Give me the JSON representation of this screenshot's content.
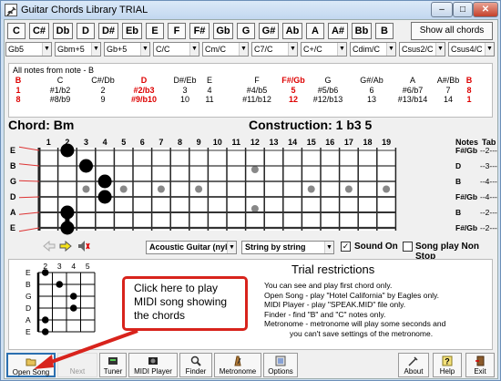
{
  "window": {
    "title": "Guitar Chords Library TRIAL",
    "min": "–",
    "max": "□",
    "close": "✕"
  },
  "note_buttons": [
    "C",
    "C#",
    "Db",
    "D",
    "D#",
    "Eb",
    "E",
    "F",
    "F#",
    "Gb",
    "G",
    "G#",
    "Ab",
    "A",
    "A#",
    "Bb",
    "B"
  ],
  "show_all_label": "Show all chords",
  "chord_dropdowns": [
    "Gb5",
    "Gbm+5",
    "Gb+5",
    "C/C",
    "Cm/C",
    "C7/C",
    "C+/C",
    "Cdim/C",
    "Csus2/C",
    "Csus4/C"
  ],
  "notes_box": {
    "title": "All notes from note - B",
    "columns": [
      {
        "r1": "B",
        "r2": "1",
        "r3": "8",
        "red": true
      },
      {
        "r1": "C",
        "r2": "#1/b2",
        "r3": "#8/b9",
        "red": false
      },
      {
        "r1": "C#/Db",
        "r2": "2",
        "r3": "9",
        "red": false
      },
      {
        "r1": "D",
        "r2": "#2/b3",
        "r3": "#9/b10",
        "red": true
      },
      {
        "r1": "D#/Eb",
        "r2": "3",
        "r3": "10",
        "red": false
      },
      {
        "r1": "E",
        "r2": "4",
        "r3": "11",
        "red": false
      },
      {
        "r1": "F",
        "r2": "#4/b5",
        "r3": "#11/b12",
        "red": false
      },
      {
        "r1": "F#/Gb",
        "r2": "5",
        "r3": "12",
        "red": true
      },
      {
        "r1": "G",
        "r2": "#5/b6",
        "r3": "#12/b13",
        "red": false
      },
      {
        "r1": "G#/Ab",
        "r2": "6",
        "r3": "13",
        "red": false
      },
      {
        "r1": "A",
        "r2": "#6/b7",
        "r3": "#13/b14",
        "red": false
      },
      {
        "r1": "A#/Bb",
        "r2": "7",
        "r3": "14",
        "red": false
      },
      {
        "r1": "B",
        "r2": "8",
        "r3": "1",
        "red": true
      }
    ]
  },
  "chord": {
    "label": "Chord: Bm",
    "construction": "Construction: 1 b3 5"
  },
  "fretboard": {
    "fret_numbers": [
      "1",
      "2",
      "3",
      "4",
      "5",
      "6",
      "7",
      "8",
      "9",
      "10",
      "11",
      "12",
      "13",
      "14",
      "15",
      "16",
      "17",
      "18",
      "19"
    ],
    "notes_header": "Notes",
    "tab_header": "Tab",
    "strings": [
      {
        "name": "E",
        "note": "F#/Gb",
        "tab": "--2---"
      },
      {
        "name": "B",
        "note": "D",
        "tab": "--3---"
      },
      {
        "name": "G",
        "note": "B",
        "tab": "--4---"
      },
      {
        "name": "D",
        "note": "F#/Gb",
        "tab": "--4---"
      },
      {
        "name": "A",
        "note": "B",
        "tab": "--2---"
      },
      {
        "name": "E",
        "note": "F#/Gb",
        "tab": "--2---"
      }
    ],
    "fingers": [
      [
        0,
        2
      ],
      [
        1,
        3
      ],
      [
        2,
        4
      ],
      [
        3,
        4
      ],
      [
        4,
        2
      ],
      [
        5,
        2
      ]
    ],
    "inlays": [
      3,
      5,
      7,
      9,
      15,
      17,
      19
    ],
    "double_inlay": 12,
    "barre": {
      "fret": 2,
      "from": 4,
      "to": 5
    }
  },
  "controls": {
    "instrument": "Acoustic Guitar (nylon",
    "strum": "String by string",
    "sound_on_label": "Sound On",
    "sound_on_checked": "✓",
    "song_play_label": "Song play Non Stop"
  },
  "mini_chart": {
    "fret_numbers": [
      "2",
      "3",
      "4",
      "5"
    ],
    "string_names": [
      "E",
      "B",
      "G",
      "D",
      "A",
      "E"
    ],
    "dots": [
      [
        0,
        0
      ],
      [
        1,
        1
      ],
      [
        2,
        2
      ],
      [
        3,
        2
      ],
      [
        4,
        0
      ],
      [
        5,
        0
      ]
    ]
  },
  "trial": {
    "title": "Trial restrictions",
    "lines": [
      "You can see and play first chord only.",
      "Open Song - play \"Hotel California\" by Eagles only.",
      "MIDI Player - play \"SPEAK.MID\" file only.",
      "Finder - find \"B\" and \"C\" notes only.",
      "Metronome - metronome will play some seconds and",
      "you can't save settings of the metronome."
    ]
  },
  "callout": {
    "text": "Click here to play MIDI song showing the chords"
  },
  "toolbar": {
    "open_song": "Open Song",
    "next": "Next",
    "tuner": "Tuner",
    "midi_player": "MIDI Player",
    "finder": "Finder",
    "metronome": "Metronome",
    "options": "Options",
    "about": "About",
    "help": "Help",
    "exit": "Exit"
  },
  "colors": {
    "accent_red": "#d8231c",
    "note_red": "#dd0000"
  }
}
